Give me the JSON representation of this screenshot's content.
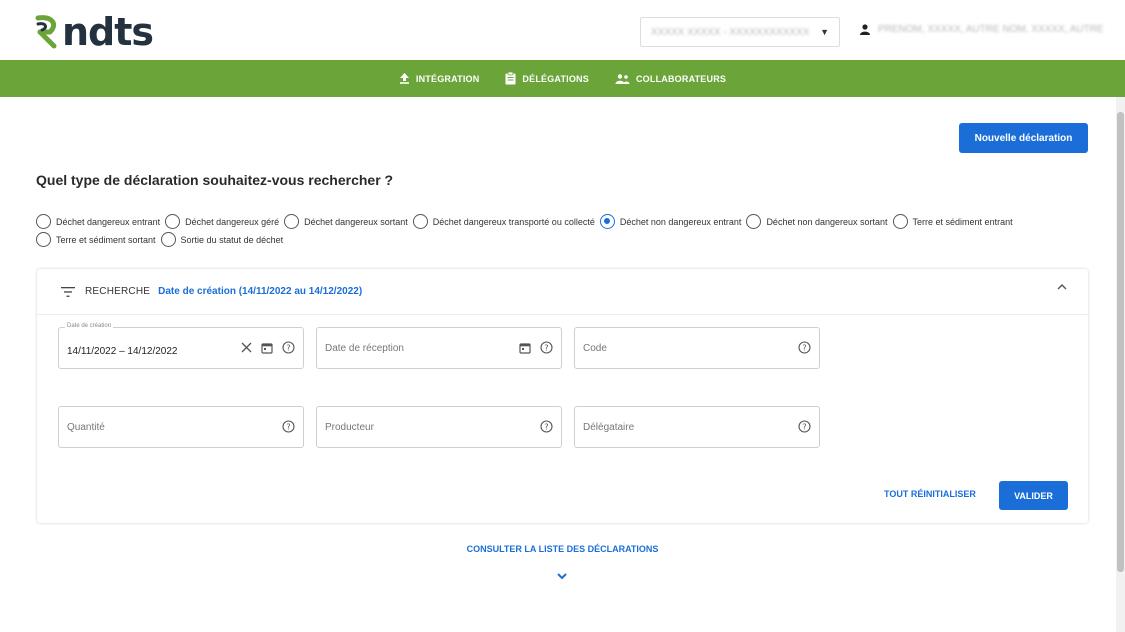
{
  "brand": {
    "name": "ndts",
    "color": "#24313f",
    "mark_color": "#6ba53a"
  },
  "header": {
    "company_select_value": "XXXXX XXXXX - XXXXXXXXXXXX",
    "user_name": "PRENOM, XXXXX, AUTRE NOM, XXXXX, AUTRE"
  },
  "nav": {
    "background": "#6ba53a",
    "items": [
      {
        "label": "INTÉGRATION",
        "icon": "upload-icon"
      },
      {
        "label": "DÉLÉGATIONS",
        "icon": "clipboard-icon"
      },
      {
        "label": "COLLABORATEURS",
        "icon": "users-icon"
      }
    ]
  },
  "actions": {
    "new_declaration": "Nouvelle déclaration"
  },
  "question": "Quel type de déclaration souhaitez-vous rechercher ?",
  "declaration_types": [
    {
      "label": "Déchet dangereux entrant",
      "checked": false
    },
    {
      "label": "Déchet dangereux géré",
      "checked": false
    },
    {
      "label": "Déchet dangereux sortant",
      "checked": false
    },
    {
      "label": "Déchet dangereux transporté ou collecté",
      "checked": false
    },
    {
      "label": "Déchet non dangereux entrant",
      "checked": true
    },
    {
      "label": "Déchet non dangereux sortant",
      "checked": false
    },
    {
      "label": "Terre et sédiment entrant",
      "checked": false
    },
    {
      "label": "Terre et sédiment sortant",
      "checked": false
    },
    {
      "label": "Sortie du statut de déchet",
      "checked": false
    }
  ],
  "search": {
    "title": "RECHERCHE",
    "criteria_summary": "Date de création (14/11/2022 au 14/12/2022)",
    "fields": {
      "creation_date": {
        "label": "Date de création",
        "value": "14/11/2022 – 14/12/2022"
      },
      "reception_date": {
        "placeholder": "Date de réception"
      },
      "code": {
        "placeholder": "Code"
      },
      "quantity": {
        "placeholder": "Quantité"
      },
      "producer": {
        "placeholder": "Producteur"
      },
      "delegate": {
        "placeholder": "Délégataire"
      }
    },
    "reset_label": "TOUT RÉINITIALISER",
    "submit_label": "VALIDER"
  },
  "footer": {
    "list_link": "CONSULTER LA LISTE DES DÉCLARATIONS"
  },
  "colors": {
    "accent": "#1b6ed8",
    "nav_green": "#6ba53a"
  }
}
